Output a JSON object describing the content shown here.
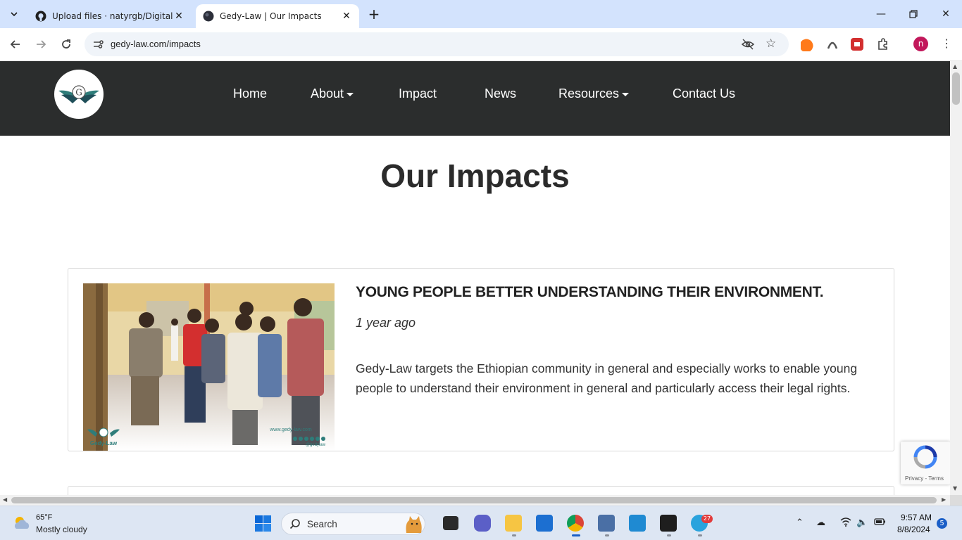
{
  "browser": {
    "tabs": [
      {
        "title": "Upload files · natyrgb/Digital-La",
        "active": false
      },
      {
        "title": "Gedy-Law | Our Impacts",
        "active": true
      }
    ],
    "url": "gedy-law.com/impacts"
  },
  "site": {
    "nav": [
      {
        "label": "Home",
        "has_dropdown": false
      },
      {
        "label": "About",
        "has_dropdown": true
      },
      {
        "label": "Impact",
        "has_dropdown": false
      },
      {
        "label": "News",
        "has_dropdown": false
      },
      {
        "label": "Resources",
        "has_dropdown": true
      },
      {
        "label": "Contact Us",
        "has_dropdown": false
      }
    ],
    "logo_letter": "G",
    "nav_bg": "#2b2d2d"
  },
  "page": {
    "title": "Our Impacts",
    "cards": [
      {
        "title": "YOUNG PEOPLE BETTER UNDERSTANDING THEIR ENVIRONMENT.",
        "date": "1 year ago",
        "body": "Gedy-Law targets the Ethiopian community in general and especially works to enable young people to understand their environment in general and particularly access their legal rights.",
        "image_watermark": "Gedy-Law",
        "image_site": "www.gedy-law.com",
        "image_handle": "@gedylaw"
      }
    ]
  },
  "recaptcha": {
    "links": "Privacy - Terms"
  },
  "taskbar": {
    "weather_temp": "65°F",
    "weather_desc": "Mostly cloudy",
    "search_label": "Search",
    "telegram_badge": "27",
    "time": "9:57 AM",
    "date": "8/8/2024",
    "notifications": "5"
  }
}
